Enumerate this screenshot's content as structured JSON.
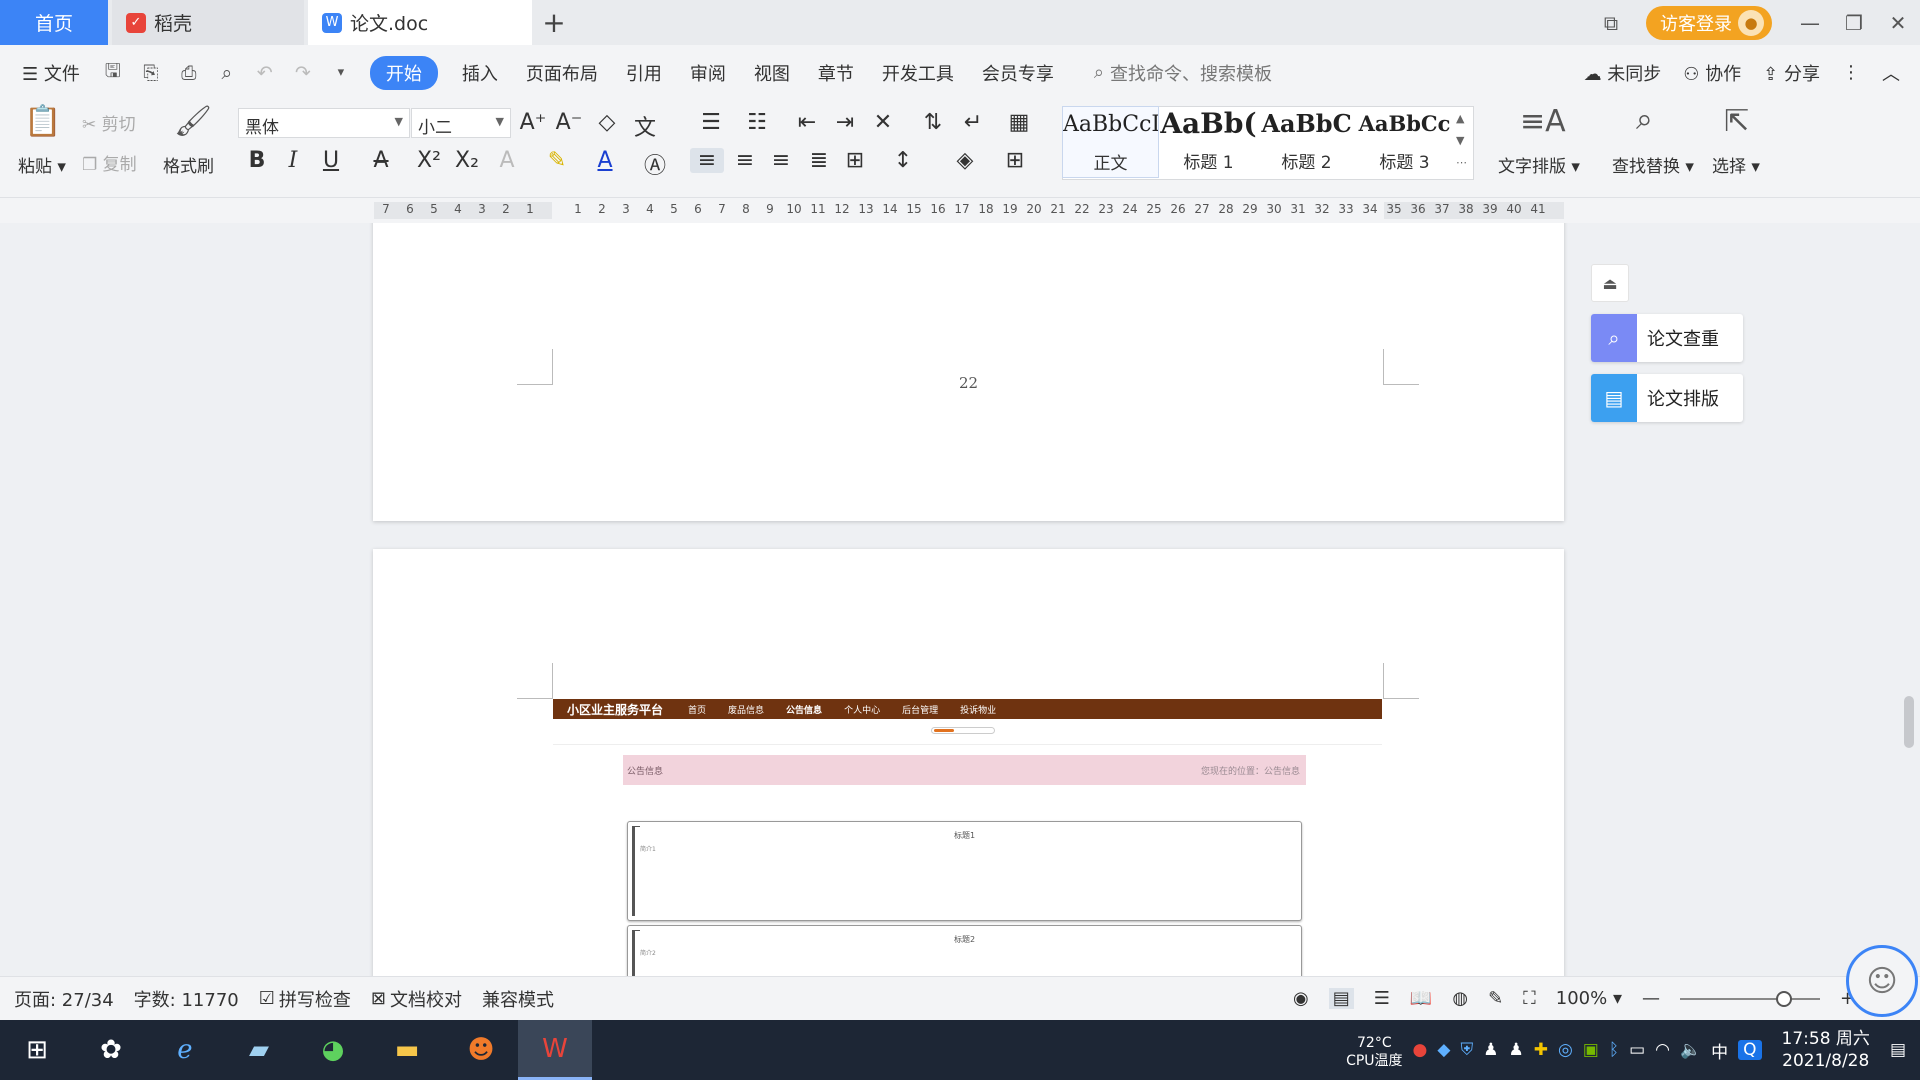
{
  "tabs": {
    "home": "首页",
    "docer": "稻壳",
    "document": "论文.doc",
    "login": "访客登录"
  },
  "menu": {
    "file": "文件",
    "items": [
      "开始",
      "插入",
      "页面布局",
      "引用",
      "审阅",
      "视图",
      "章节",
      "开发工具",
      "会员专享"
    ],
    "search_placeholder": "查找命令、搜索模板",
    "unsynced": "未同步",
    "collab": "协作",
    "share": "分享"
  },
  "ribbon": {
    "paste": "粘贴",
    "cut": "剪切",
    "copy": "复制",
    "format_painter": "格式刷",
    "font_name": "黑体",
    "font_size": "小二",
    "styles": [
      {
        "sample": "AaBbCcI",
        "name": "正文"
      },
      {
        "sample": "AaBb(",
        "name": "标题 1"
      },
      {
        "sample": "AaBbC",
        "name": "标题 2"
      },
      {
        "sample": "AaBbCc",
        "name": "标题 3"
      }
    ],
    "text_layout": "文字排版",
    "find_replace": "查找替换",
    "select": "选择"
  },
  "ruler": {
    "ticks": [
      "7",
      "6",
      "5",
      "4",
      "3",
      "2",
      "1",
      "",
      "1",
      "2",
      "3",
      "4",
      "5",
      "6",
      "7",
      "8",
      "9",
      "10",
      "11",
      "12",
      "13",
      "14",
      "15",
      "16",
      "17",
      "18",
      "19",
      "20",
      "21",
      "22",
      "23",
      "24",
      "25",
      "26",
      "27",
      "28",
      "29",
      "30",
      "31",
      "32",
      "33",
      "34",
      "35",
      "36",
      "37",
      "38",
      "39",
      "40",
      "41"
    ]
  },
  "document": {
    "page_number": "22",
    "screenshot": {
      "brand": "小区业主服务平台",
      "nav": [
        "首页",
        "废品信息",
        "公告信息",
        "个人中心",
        "后台管理",
        "投诉物业"
      ],
      "bar_left": "公告信息",
      "bar_right": "您现在的位置：公告信息",
      "cards": [
        {
          "title": "标题1",
          "line": "简介1"
        },
        {
          "title": "标题2",
          "line": "简介2"
        }
      ]
    }
  },
  "side_panel": {
    "check": "论文查重",
    "layout": "论文排版"
  },
  "status": {
    "page": "页面: 27/34",
    "words": "字数: 11770",
    "spell": "拼写检查",
    "proof": "文档校对",
    "compat": "兼容模式",
    "zoom": "100%"
  },
  "taskbar": {
    "temp": "72°C",
    "temp_label": "CPU温度",
    "ime": "中",
    "time": "17:58 周六",
    "date": "2021/8/28"
  }
}
